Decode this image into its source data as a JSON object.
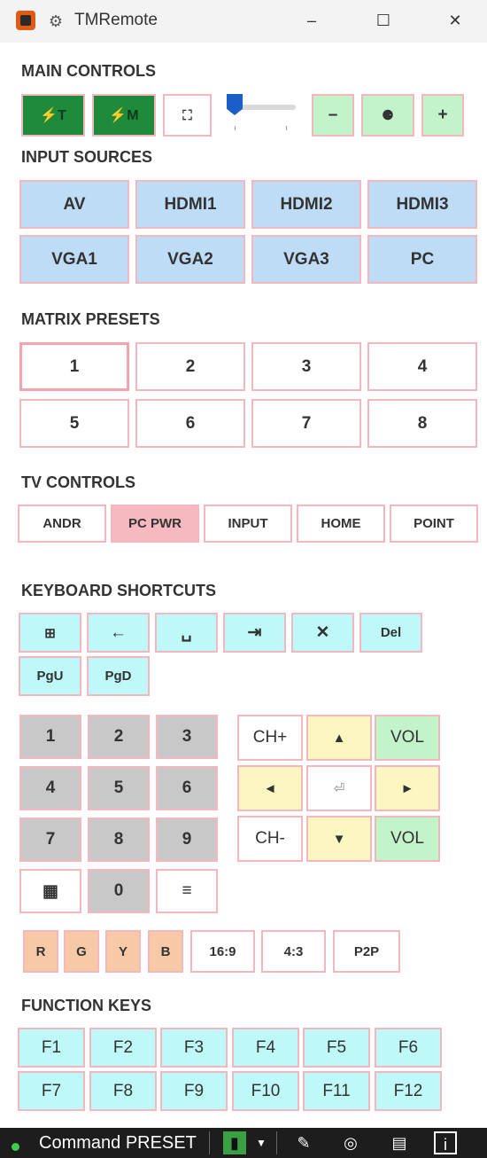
{
  "window": {
    "title": "TMRemote",
    "minimize": "–",
    "maximize": "☐",
    "close": "✕"
  },
  "sections": {
    "main_controls": "MAIN CONTROLS",
    "input_sources": "INPUT SOURCES",
    "matrix_presets": "MATRIX PRESETS",
    "tv_controls": "TV CONTROLS",
    "keyboard_shortcuts": "KEYBOARD SHORTCUTS",
    "function_keys": "FUNCTION KEYS"
  },
  "main_controls": {
    "power_t": "⚡T",
    "power_m": "⚡M",
    "pointer": "⛶",
    "minus": "–",
    "mid": "⚈",
    "plus": "+",
    "slider_value": 0.0
  },
  "input_sources": [
    "AV",
    "HDMI1",
    "HDMI2",
    "HDMI3",
    "VGA1",
    "VGA2",
    "VGA3",
    "PC"
  ],
  "matrix_presets": [
    "1",
    "2",
    "3",
    "4",
    "5",
    "6",
    "7",
    "8"
  ],
  "tv_controls": [
    "ANDR",
    "PC PWR",
    "INPUT",
    "HOME",
    "POINT"
  ],
  "keyboard_shortcuts": [
    "⊞",
    "←",
    "␣",
    "⇥",
    "✕",
    "Del",
    "PgU",
    "PgD"
  ],
  "numpad": [
    "1",
    "2",
    "3",
    "4",
    "5",
    "6",
    "7",
    "8",
    "9",
    "▦",
    "0",
    "≡"
  ],
  "nav": {
    "ch_plus": "CH+",
    "up": "▲",
    "vol_up": "VOL",
    "left": "◄",
    "enter": "⏎",
    "right": "►",
    "ch_minus": "CH-",
    "down": "▼",
    "vol_down": "VOL"
  },
  "color_keys": [
    "R",
    "G",
    "Y",
    "B",
    "16:9",
    "4:3",
    "P2P"
  ],
  "function_keys": [
    "F1",
    "F2",
    "F3",
    "F4",
    "F5",
    "F6",
    "F7",
    "F8",
    "F9",
    "F10",
    "F11",
    "F12"
  ],
  "status": {
    "text": "Command PRESET"
  }
}
